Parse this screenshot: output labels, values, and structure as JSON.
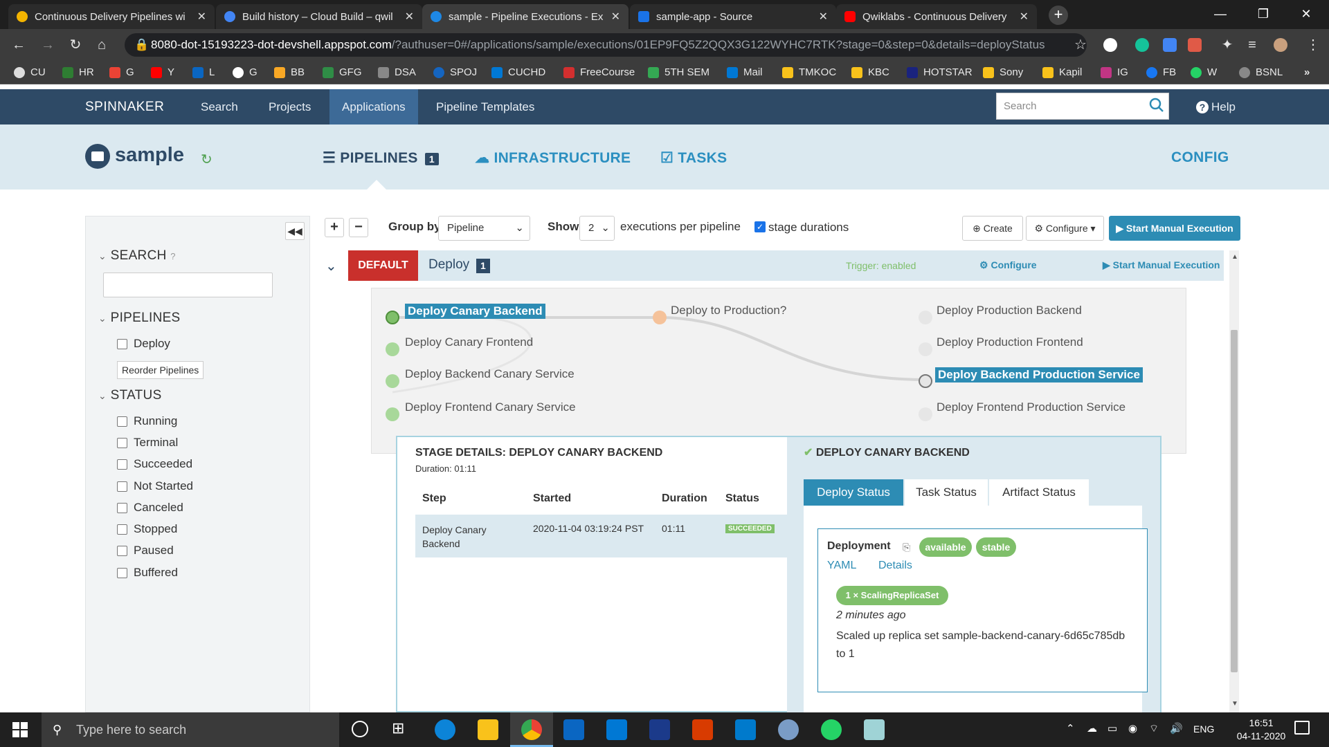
{
  "browser": {
    "tabs": [
      {
        "title": "Continuous Delivery Pipelines wi",
        "color": "#f4b400"
      },
      {
        "title": "Build history – Cloud Build – qwil",
        "color": "#4285f4"
      },
      {
        "title": "sample - Pipeline Executions - Ex",
        "color": "#1e88e5"
      },
      {
        "title": "sample-app - Source",
        "color": "#1a73e8"
      },
      {
        "title": "Qwiklabs - Continuous Delivery",
        "color": "#ff0000"
      }
    ],
    "url_host": "8080-dot-15193223-dot-devshell.appspot.com",
    "url_rest": "/?authuser=0#/applications/sample/executions/01EP9FQ5Z2QQX3G122WYHC7RTK?stage=0&step=0&details=deployStatus",
    "bookmarks": [
      "CU",
      "HR",
      "G",
      "Y",
      "L",
      "G",
      "BB",
      "GFG",
      "DSA",
      "SPOJ",
      "CUCHD",
      "FreeCourse",
      "5TH SEM",
      "Mail",
      "TMKOC",
      "KBC",
      "HOTSTAR",
      "Sony",
      "Kapil",
      "IG",
      "FB",
      "W",
      "BSNL"
    ]
  },
  "header": {
    "brand": "SPINNAKER",
    "nav": [
      "Search",
      "Projects",
      "Applications",
      "Pipeline Templates"
    ],
    "active_nav": "Applications",
    "search_placeholder": "Search",
    "help": "Help"
  },
  "app": {
    "name": "sample",
    "tabs": {
      "pipelines": "PIPELINES",
      "pipelines_count": "1",
      "infrastructure": "INFRASTRUCTURE",
      "tasks": "TASKS",
      "config": "CONFIG"
    }
  },
  "sidebar": {
    "search_label": "SEARCH",
    "pipelines_label": "PIPELINES",
    "pipelines": [
      "Deploy"
    ],
    "reorder_label": "Reorder Pipelines",
    "status_label": "STATUS",
    "statuses": [
      "Running",
      "Terminal",
      "Succeeded",
      "Not Started",
      "Canceled",
      "Stopped",
      "Paused",
      "Buffered"
    ]
  },
  "toolbar": {
    "group_by_label": "Group by",
    "group_by_value": "Pipeline",
    "show_label": "Show",
    "show_value": "2",
    "executions_label": "executions per pipeline",
    "stage_durations_label": "stage durations",
    "create_label": "Create",
    "configure_label": "Configure",
    "start_label": "Start Manual Execution"
  },
  "pipeline": {
    "default_label": "DEFAULT",
    "name": "Deploy",
    "count": "1",
    "trigger": "Trigger: enabled",
    "configure": "Configure",
    "start": "Start Manual Execution",
    "stages_col1": [
      "Deploy Canary Backend",
      "Deploy Canary Frontend",
      "Deploy Backend Canary Service",
      "Deploy Frontend Canary Service"
    ],
    "stage_mid": "Deploy to Production?",
    "stages_col3": [
      "Deploy Production Backend",
      "Deploy Production Frontend",
      "Deploy Backend Production Service",
      "Deploy Frontend Production Service"
    ]
  },
  "stage_details": {
    "title": "STAGE DETAILS: DEPLOY CANARY BACKEND",
    "duration": "Duration: 01:11",
    "columns": [
      "Step",
      "Started",
      "Duration",
      "Status"
    ],
    "row": {
      "step_line1": "Deploy Canary",
      "step_line2": "Backend",
      "started": "2020-11-04 03:19:24 PST",
      "duration": "01:11",
      "status": "SUCCEEDED"
    }
  },
  "deploy_panel": {
    "title": "DEPLOY CANARY BACKEND",
    "tabs": [
      "Deploy Status",
      "Task Status",
      "Artifact Status"
    ],
    "deployment_label": "Deployment",
    "badges": [
      "available",
      "stable"
    ],
    "yaml": "YAML",
    "details": "Details",
    "replica_badge": "1 × ScalingReplicaSet",
    "ago": "2 minutes ago",
    "message_line1": "Scaled up replica set sample-backend-canary-6d65c785db",
    "message_line2": "to 1"
  },
  "taskbar": {
    "search_placeholder": "Type here to search",
    "lang": "ENG",
    "time": "16:51",
    "date": "04-11-2020"
  },
  "colors": {
    "accent": "#2d8cb4",
    "header": "#2e4a66",
    "success": "#7fbf6a",
    "default_red": "#c9302c"
  }
}
